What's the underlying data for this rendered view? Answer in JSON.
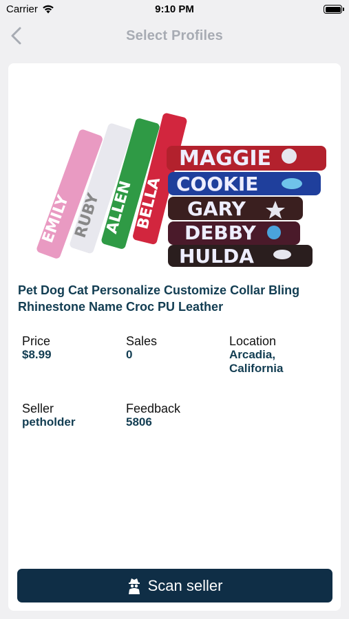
{
  "status_bar": {
    "carrier": "Carrier",
    "time": "9:10 PM",
    "battery_level": 1.0
  },
  "nav": {
    "title": "Select Profiles",
    "back_icon": "chevron-left-icon"
  },
  "product": {
    "title": "Pet Dog Cat Personalize Customize Collar Bling Rhinestone Name Croc PU Leather",
    "image_names": [
      "EMILY",
      "RUBY",
      "ALLEN",
      "BELLA",
      "MAGGIE",
      "COOKIE",
      "GARY",
      "DEBBY",
      "HULDA"
    ]
  },
  "details": {
    "price_label": "Price",
    "price_value": "$8.99",
    "sales_label": "Sales",
    "sales_value": "0",
    "location_label": "Location",
    "location_value_line1": "Arcadia,",
    "location_value_line2": "California",
    "seller_label": "Seller",
    "seller_value": "petholder",
    "feedback_label": "Feedback",
    "feedback_value": "5806"
  },
  "actions": {
    "scan_label": "Scan seller",
    "scan_icon": "spy-icon"
  },
  "colors": {
    "accent": "#123d52",
    "button_bg": "#0f2e46",
    "nav_title": "#a7abb3",
    "background": "#f0f0f2"
  }
}
